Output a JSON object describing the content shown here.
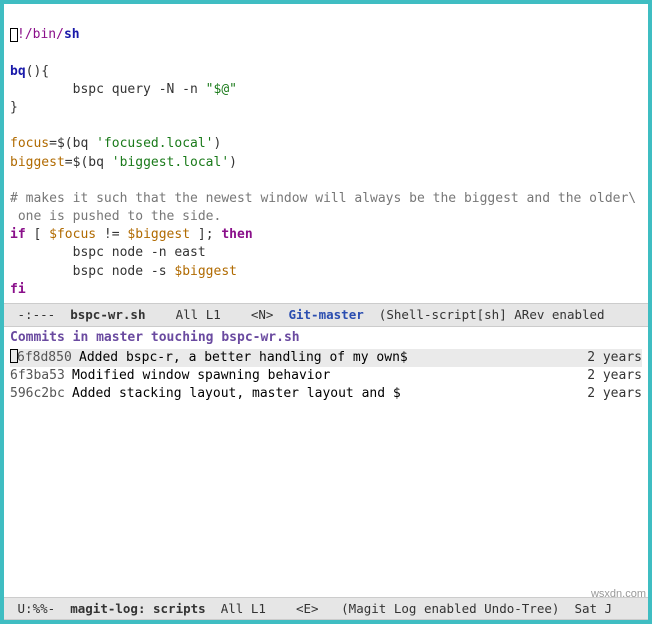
{
  "code": {
    "shebang_prefix": "!/bin/",
    "shebang_shell": "sh",
    "l3a": "bq",
    "l3b": "(){",
    "l4a": "        bspc query -N -n ",
    "l4b": "\"$@\"",
    "l5": "}",
    "l7a": "focus",
    "l7b": "=$(",
    "l7c": "bq",
    "l7d": " ",
    "l7e": "'focused.local'",
    "l7f": ")",
    "l8a": "biggest",
    "l8b": "=$(",
    "l8c": "bq",
    "l8d": " ",
    "l8e": "'biggest.local'",
    "l8f": ")",
    "comment1": "# makes it such that the newest window will always be the biggest and the older\\",
    "comment2": " one is pushed to the side.",
    "l11a": "if",
    "l11b": " [ ",
    "l11c": "$focus",
    "l11d": " != ",
    "l11e": "$biggest",
    "l11f": " ]; ",
    "l11g": "then",
    "l12": "        bspc node -n east",
    "l13a": "        bspc node -s ",
    "l13b": "$biggest",
    "l14": "fi"
  },
  "modeline1": {
    "left": " -:---  ",
    "file": "bspc-wr.sh",
    "pos": "    All L1    <N>  ",
    "git": "Git-master",
    "mode": "  (Shell-script[sh] ARev enabled"
  },
  "magit": {
    "header_a": "Commits in ",
    "header_b": "master",
    "header_c": " touching ",
    "header_d": "bspc-wr.sh",
    "commits": [
      {
        "hash": "6f8d850",
        "msg": "Added bspc-r, a better handling of my own$",
        "blur": "      ",
        "age": "2 years",
        "hl": true
      },
      {
        "hash": "6f3ba53",
        "msg": "Modified window spawning behavior",
        "blur": "",
        "age": "2 years",
        "hl": false
      },
      {
        "hash": "596c2bc",
        "msg": "Added stacking layout, master layout and $",
        "blur": "      ",
        "age": "2 years",
        "hl": false
      }
    ]
  },
  "modeline2": {
    "left": " U:%%-  ",
    "file": "magit-log: scripts",
    "pos": "  All L1    <E>   ",
    "mode": "(Magit Log enabled Undo-Tree)  Sat J"
  },
  "watermark": "wsxdn.com"
}
